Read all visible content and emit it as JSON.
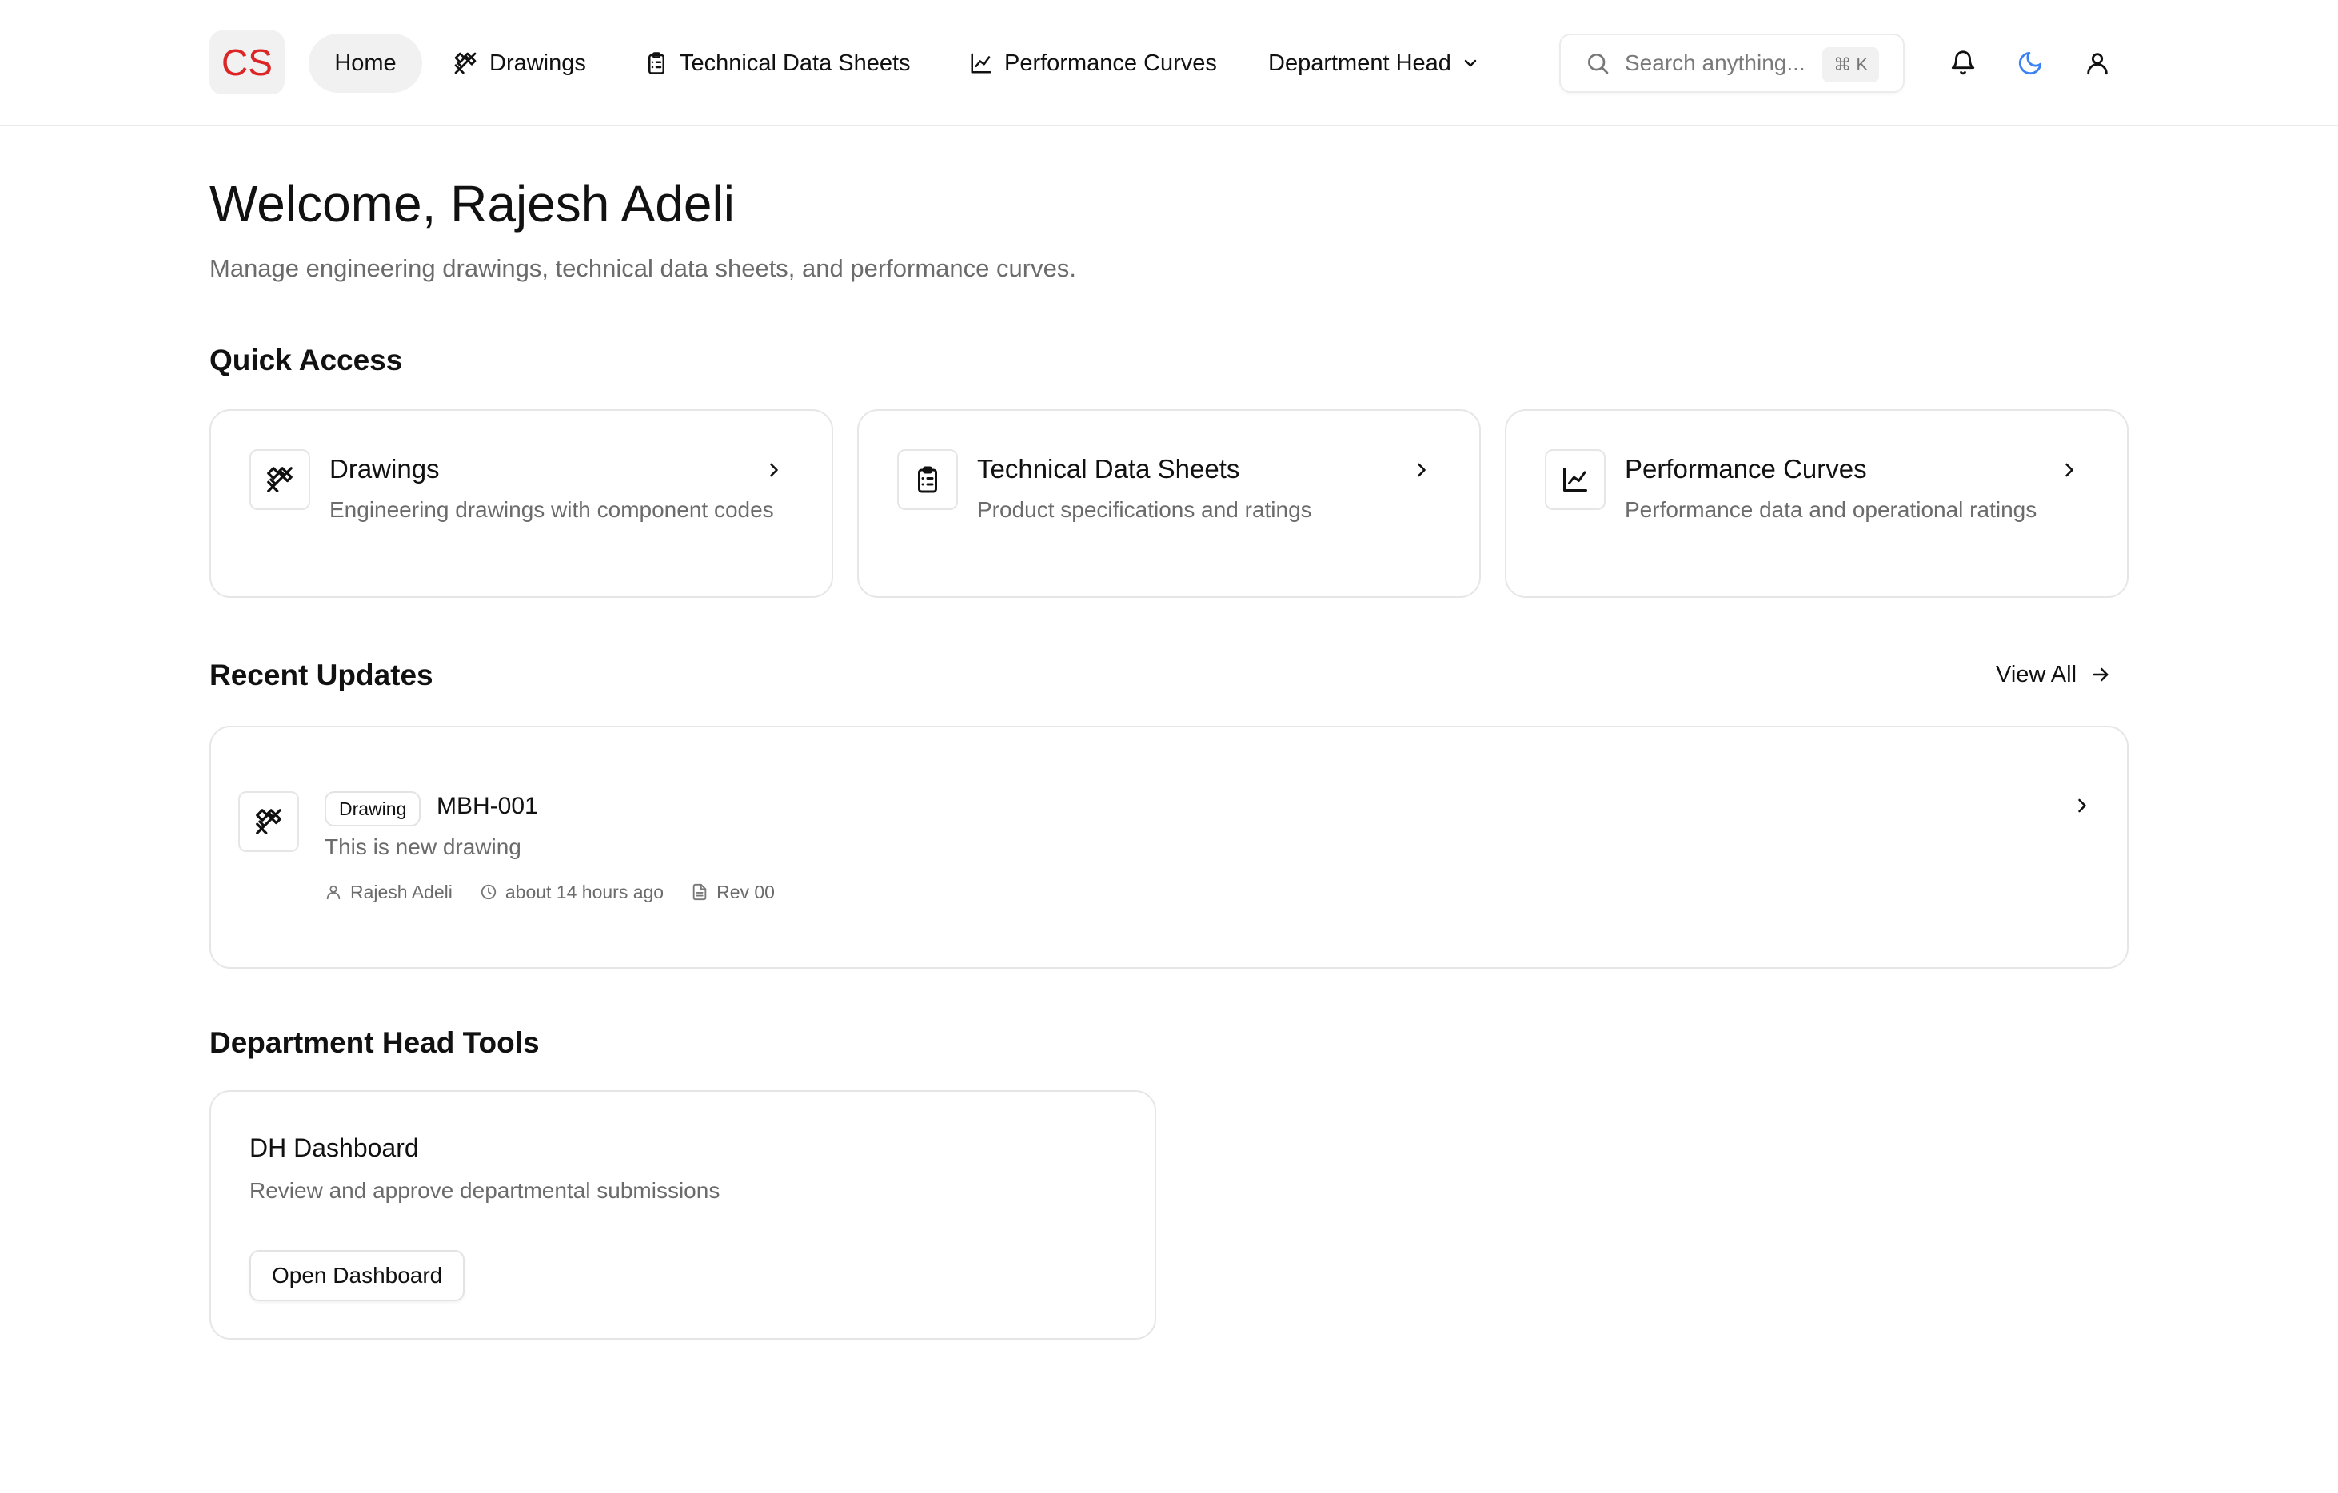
{
  "app": {
    "logo_text": "CS"
  },
  "nav": {
    "home": "Home",
    "drawings": "Drawings",
    "technical_data_sheets": "Technical Data Sheets",
    "performance_curves": "Performance Curves",
    "department_head": "Department Head"
  },
  "search": {
    "placeholder": "Search anything...",
    "shortcut": "⌘ K"
  },
  "header_icons": [
    "bell-icon",
    "moon-icon",
    "user-icon"
  ],
  "welcome": {
    "title": "Welcome, Rajesh Adeli",
    "subtitle": "Manage engineering drawings, technical data sheets, and performance curves."
  },
  "quick_access": {
    "title": "Quick Access",
    "cards": [
      {
        "name": "Drawings",
        "description": "Engineering drawings with component codes",
        "icon": "drafting-tools-icon"
      },
      {
        "name": "Technical Data Sheets",
        "description": "Product specifications and ratings",
        "icon": "clipboard-list-icon"
      },
      {
        "name": "Performance Curves",
        "description": "Performance data and operational ratings",
        "icon": "line-chart-icon"
      }
    ]
  },
  "recent_updates": {
    "title": "Recent Updates",
    "view_all": "View All",
    "items": [
      {
        "type_badge": "Drawing",
        "code": "MBH-001",
        "description": "This is new drawing",
        "author": "Rajesh Adeli",
        "time": "about 14 hours ago",
        "revision": "Rev 00"
      }
    ]
  },
  "department_head_tools": {
    "title": "Department Head Tools",
    "card": {
      "name": "DH Dashboard",
      "description": "Review and approve departmental submissions",
      "button": "Open Dashboard"
    }
  },
  "colors": {
    "brand_red": "#dc2626",
    "moon_blue": "#3b82f6",
    "muted_text": "#6b6b6b",
    "border": "#e6e6e6"
  }
}
